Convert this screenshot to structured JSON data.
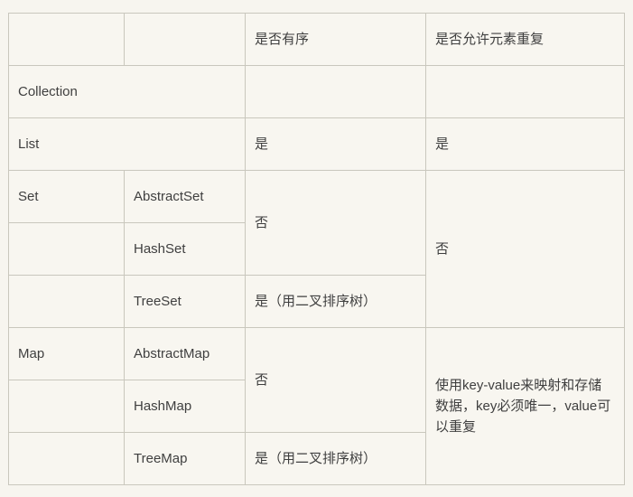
{
  "table": {
    "name": "java-collection-comparison-table",
    "colors": {
      "page_background": "#f7f5ef",
      "cell_background": "#f8f6f0",
      "border": "#c9c7bd",
      "text": "#3f3f3f"
    },
    "header": {
      "col1": "",
      "col2": "",
      "col3": "是否有序",
      "col4": "是否允许元素重复"
    },
    "rows": [
      {
        "type": "collection",
        "name": "Collection",
        "impl": "",
        "ordered": "",
        "duplicates": ""
      },
      {
        "type": "list",
        "name": "List",
        "impl": "",
        "ordered": "是",
        "duplicates": "是"
      },
      {
        "type": "set-abstractset",
        "name": "Set",
        "impl": "AbstractSet",
        "ordered": "否",
        "duplicates": "否"
      },
      {
        "type": "set-hashset",
        "name": "",
        "impl": "HashSet",
        "ordered": "",
        "duplicates": ""
      },
      {
        "type": "set-treeset",
        "name": "",
        "impl": "TreeSet",
        "ordered": "是（用二叉排序树）",
        "duplicates": ""
      },
      {
        "type": "map-abstractmap",
        "name": "Map",
        "impl": "AbstractMap",
        "ordered": "否",
        "duplicates": "使用key-value来映射和存储数据，key必须唯一，value可以重复"
      },
      {
        "type": "map-hashmap",
        "name": "",
        "impl": "HashMap",
        "ordered": "",
        "duplicates": ""
      },
      {
        "type": "map-treemap",
        "name": "",
        "impl": "TreeMap",
        "ordered": "是（用二叉排序树）",
        "duplicates": ""
      }
    ]
  }
}
